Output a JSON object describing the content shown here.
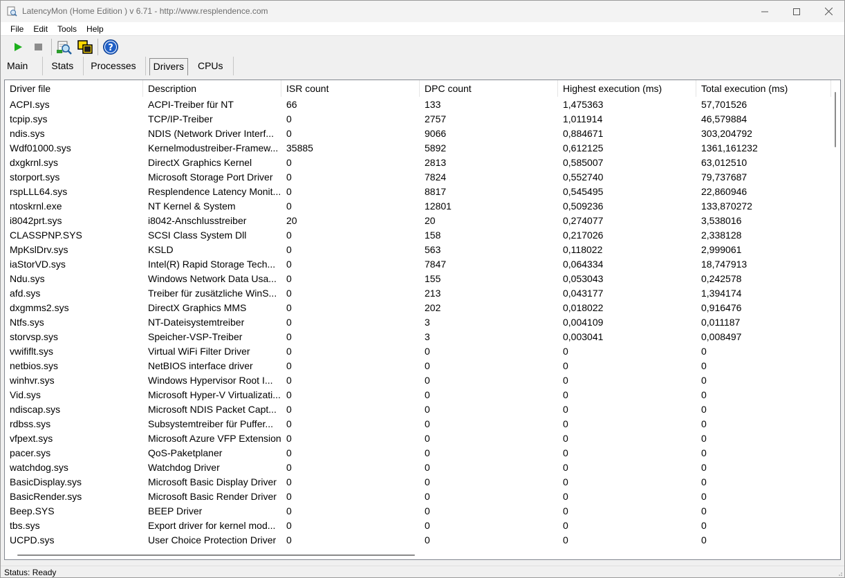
{
  "window": {
    "title": "LatencyMon  (Home Edition )  v 6.71 - http://www.resplendence.com"
  },
  "menu": {
    "items": [
      "File",
      "Edit",
      "Tools",
      "Help"
    ]
  },
  "toolbar": {
    "icons": [
      "play-icon",
      "stop-icon",
      "search-icon",
      "windows-icon",
      "help-icon"
    ]
  },
  "tabs": [
    "Main",
    "Stats",
    "Processes",
    "Drivers",
    "CPUs"
  ],
  "active_tab": "Drivers",
  "table": {
    "columns": [
      "Driver file",
      "Description",
      "ISR count",
      "DPC count",
      "Highest execution (ms)",
      "Total execution (ms)"
    ],
    "rows": [
      [
        "ACPI.sys",
        "ACPI-Treiber für NT",
        "66",
        "133",
        "1,475363",
        "57,701526"
      ],
      [
        "tcpip.sys",
        "TCP/IP-Treiber",
        "0",
        "2757",
        "1,011914",
        "46,579884"
      ],
      [
        "ndis.sys",
        "NDIS (Network Driver Interf...",
        "0",
        "9066",
        "0,884671",
        "303,204792"
      ],
      [
        "Wdf01000.sys",
        "Kernelmodustreiber-Framew...",
        "35885",
        "5892",
        "0,612125",
        "1361,161232"
      ],
      [
        "dxgkrnl.sys",
        "DirectX Graphics Kernel",
        "0",
        "2813",
        "0,585007",
        "63,012510"
      ],
      [
        "storport.sys",
        "Microsoft Storage Port Driver",
        "0",
        "7824",
        "0,552740",
        "79,737687"
      ],
      [
        "rspLLL64.sys",
        "Resplendence Latency Monit...",
        "0",
        "8817",
        "0,545495",
        "22,860946"
      ],
      [
        "ntoskrnl.exe",
        "NT Kernel & System",
        "0",
        "12801",
        "0,509236",
        "133,870272"
      ],
      [
        "i8042prt.sys",
        "i8042-Anschlusstreiber",
        "20",
        "20",
        "0,274077",
        "3,538016"
      ],
      [
        "CLASSPNP.SYS",
        "SCSI Class System Dll",
        "0",
        "158",
        "0,217026",
        "2,338128"
      ],
      [
        "MpKslDrv.sys",
        "KSLD",
        "0",
        "563",
        "0,118022",
        "2,999061"
      ],
      [
        "iaStorVD.sys",
        "Intel(R) Rapid Storage Tech...",
        "0",
        "7847",
        "0,064334",
        "18,747913"
      ],
      [
        "Ndu.sys",
        "Windows Network Data Usa...",
        "0",
        "155",
        "0,053043",
        "0,242578"
      ],
      [
        "afd.sys",
        "Treiber für zusätzliche WinS...",
        "0",
        "213",
        "0,043177",
        "1,394174"
      ],
      [
        "dxgmms2.sys",
        "DirectX Graphics MMS",
        "0",
        "202",
        "0,018022",
        "0,916476"
      ],
      [
        "Ntfs.sys",
        "NT-Dateisystemtreiber",
        "0",
        "3",
        "0,004109",
        "0,011187"
      ],
      [
        "storvsp.sys",
        "Speicher-VSP-Treiber",
        "0",
        "3",
        "0,003041",
        "0,008497"
      ],
      [
        "vwififlt.sys",
        "Virtual WiFi Filter Driver",
        "0",
        "0",
        "0",
        "0"
      ],
      [
        "netbios.sys",
        "NetBIOS interface driver",
        "0",
        "0",
        "0",
        "0"
      ],
      [
        "winhvr.sys",
        "Windows Hypervisor Root I...",
        "0",
        "0",
        "0",
        "0"
      ],
      [
        "Vid.sys",
        "Microsoft Hyper-V Virtualizati...",
        "0",
        "0",
        "0",
        "0"
      ],
      [
        "ndiscap.sys",
        "Microsoft NDIS Packet Capt...",
        "0",
        "0",
        "0",
        "0"
      ],
      [
        "rdbss.sys",
        "Subsystemtreiber für Puffer...",
        "0",
        "0",
        "0",
        "0"
      ],
      [
        "vfpext.sys",
        "Microsoft Azure VFP Extension",
        "0",
        "0",
        "0",
        "0"
      ],
      [
        "pacer.sys",
        "QoS-Paketplaner",
        "0",
        "0",
        "0",
        "0"
      ],
      [
        "watchdog.sys",
        "Watchdog Driver",
        "0",
        "0",
        "0",
        "0"
      ],
      [
        "BasicDisplay.sys",
        "Microsoft Basic Display Driver",
        "0",
        "0",
        "0",
        "0"
      ],
      [
        "BasicRender.sys",
        "Microsoft Basic Render Driver",
        "0",
        "0",
        "0",
        "0"
      ],
      [
        "Beep.SYS",
        "BEEP Driver",
        "0",
        "0",
        "0",
        "0"
      ],
      [
        "tbs.sys",
        "Export driver for kernel mod...",
        "0",
        "0",
        "0",
        "0"
      ],
      [
        "UCPD.sys",
        "User Choice Protection Driver",
        "0",
        "0",
        "0",
        "0"
      ]
    ]
  },
  "status": {
    "text": "Status: Ready"
  }
}
